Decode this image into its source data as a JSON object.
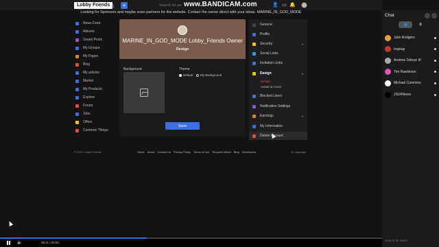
{
  "header": {
    "logo": "Lobby Friends",
    "search_placeholder": "Search for pe",
    "watermark": "www.BANDICAM.com"
  },
  "announcement": "Looking for Sponsors and maybe even partners for the website. Contact the owner direct with your ideas. MARINE_IN_GOD_MODE",
  "sidebar": {
    "items": [
      {
        "label": "News Feed",
        "color": "#3b6fe0"
      },
      {
        "label": "Albums",
        "color": "#3b6fe0"
      },
      {
        "label": "Saved Posts",
        "color": "#9b59b6"
      },
      {
        "label": "My Groups",
        "color": "#3b6fe0"
      },
      {
        "label": "My Pages",
        "color": "#e67e22"
      },
      {
        "label": "Blog",
        "color": "#e74c3c"
      },
      {
        "label": "My articles",
        "color": "#3b6fe0"
      },
      {
        "label": "Market",
        "color": "#3b6fe0"
      },
      {
        "label": "My Products",
        "color": "#3b6fe0"
      },
      {
        "label": "Explore",
        "color": "#3b6fe0"
      },
      {
        "label": "Forum",
        "color": "#e74c3c"
      },
      {
        "label": "Jobs",
        "color": "#3b6fe0"
      },
      {
        "label": "Offers",
        "color": "#f1c40f"
      },
      {
        "label": "Common Things",
        "color": "#e74c3c"
      }
    ]
  },
  "profile": {
    "name": "MARINE_IN_GOD_MODE Lobby_Friends Owner",
    "subtitle": "Design"
  },
  "design_panel": {
    "background_label": "Background",
    "theme_label": "Theme",
    "theme_options": [
      "Default",
      "My Background"
    ],
    "save_label": "Save"
  },
  "settings_menu": {
    "items": [
      {
        "label": "General",
        "color": "#444"
      },
      {
        "label": "Profile",
        "color": "#3b6fe0"
      },
      {
        "label": "Security",
        "color": "#f1c40f",
        "chevron": "▾"
      },
      {
        "label": "Social Links",
        "color": "#3b9be0"
      },
      {
        "label": "Invitation Links",
        "color": "#3b6fe0"
      },
      {
        "label": "Design",
        "color": "#f1c40f",
        "chevron": "▾"
      },
      {
        "label": "Blocked Users",
        "color": "#3b6fe0"
      },
      {
        "label": "Notification Settings",
        "color": "#7b5be0"
      },
      {
        "label": "Earnings",
        "color": "#e67e22",
        "chevron": "▾"
      },
      {
        "label": "My Information",
        "color": "#3b6fe0"
      },
      {
        "label": "Delete Account",
        "color": "#e74c3c"
      }
    ],
    "design_sub": [
      "Design",
      "Avatar & Cover"
    ],
    "active_sub_color": "#e74c3c"
  },
  "footer": {
    "copyright": "© 2021 Lobby Friends",
    "links": [
      "Home",
      "About",
      "Contact Us",
      "Privacy Policy",
      "Terms of Use",
      "Request refund",
      "Blog",
      "Developers"
    ],
    "language": "Language"
  },
  "chat": {
    "title": "Chat",
    "users": [
      {
        "name": "Julie Rodgers",
        "color": "#e6a23c"
      },
      {
        "name": "Impkap",
        "color": "#c0392b"
      },
      {
        "name": "Andrew Zebrun III",
        "color": "#aaaaaa"
      },
      {
        "name": "Tim Rawlinson",
        "color": "#e056b8"
      },
      {
        "name": "Michael Cummins",
        "color": "#ffffff"
      },
      {
        "name": "JSUKNews",
        "color": "#000000"
      }
    ],
    "search_placeholder": "Search for users"
  },
  "player": {
    "time": "00:11 / 00:52",
    "progress": 0.385
  }
}
